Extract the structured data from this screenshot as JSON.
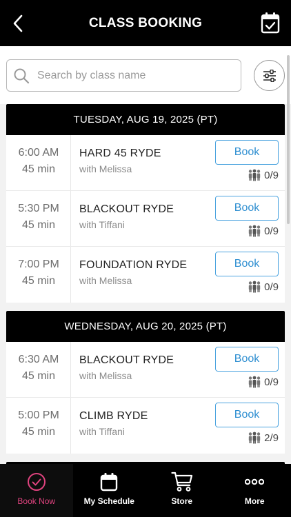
{
  "header": {
    "title": "CLASS BOOKING"
  },
  "search": {
    "placeholder": "Search by class name",
    "value": ""
  },
  "days": [
    {
      "label": "TUESDAY, AUG 19, 2025 (PT)",
      "classes": [
        {
          "time": "6:00 AM",
          "duration": "45 min",
          "name": "HARD 45 RYDE",
          "instructor": "with Melissa",
          "book_label": "Book",
          "capacity": "0/9"
        },
        {
          "time": "5:30 PM",
          "duration": "45 min",
          "name": "BLACKOUT RYDE",
          "instructor": "with Tiffani",
          "book_label": "Book",
          "capacity": "0/9"
        },
        {
          "time": "7:00 PM",
          "duration": "45 min",
          "name": "FOUNDATION RYDE",
          "instructor": "with Melissa",
          "book_label": "Book",
          "capacity": "0/9"
        }
      ]
    },
    {
      "label": "WEDNESDAY, AUG 20, 2025 (PT)",
      "classes": [
        {
          "time": "6:30 AM",
          "duration": "45 min",
          "name": "BLACKOUT RYDE",
          "instructor": "with Melissa",
          "book_label": "Book",
          "capacity": "0/9"
        },
        {
          "time": "5:00 PM",
          "duration": "45 min",
          "name": "CLIMB RYDE",
          "instructor": "with Tiffani",
          "book_label": "Book",
          "capacity": "2/9"
        }
      ]
    }
  ],
  "bottom_nav": {
    "items": [
      {
        "label": "Book Now",
        "icon": "check-circle-icon",
        "active": true
      },
      {
        "label": "My Schedule",
        "icon": "calendar-icon",
        "active": false
      },
      {
        "label": "Store",
        "icon": "cart-icon",
        "active": false
      },
      {
        "label": "More",
        "icon": "more-dots-icon",
        "active": false
      }
    ]
  },
  "colors": {
    "accent": "#e0437f",
    "book_button": "#2f8fd1",
    "header_bg": "#000000"
  }
}
